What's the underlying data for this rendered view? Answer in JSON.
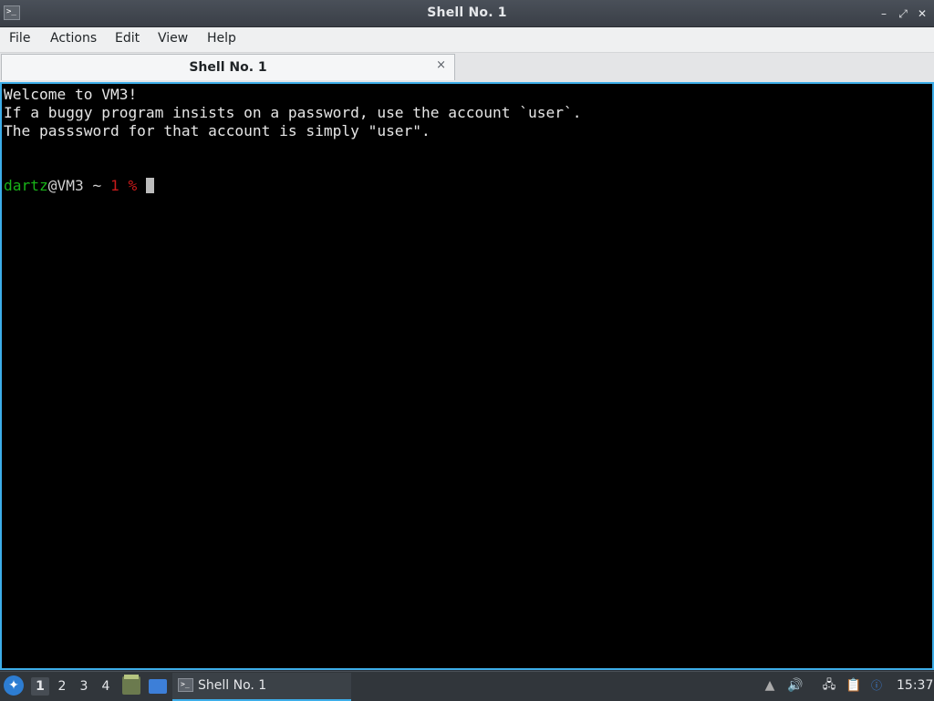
{
  "window": {
    "title": "Shell No. 1",
    "icon": "terminal-icon",
    "controls": {
      "minimize": "–",
      "maximize": "⤢",
      "close": "✕"
    }
  },
  "menu": {
    "file": "File",
    "actions": "Actions",
    "edit": "Edit",
    "view": "View",
    "help": "Help"
  },
  "tabs": [
    {
      "label": "Shell No. 1",
      "close": "×"
    }
  ],
  "terminal": {
    "lines": [
      "Welcome to VM3!",
      "If a buggy program insists on a password, use the account `user`.",
      "The passsword for that account is simply \"user\"."
    ],
    "prompt": {
      "user": "dartz",
      "host": "@VM3",
      "path": " ~ ",
      "num": "1 %",
      "input": ""
    }
  },
  "taskbar": {
    "launcher": "launcher-icon",
    "desktops": [
      "1",
      "2",
      "3",
      "4"
    ],
    "active_desktop": "1",
    "task_label": "Shell No. 1",
    "clock": "15:37"
  },
  "colors": {
    "accent": "#3daee9",
    "prompt_user": "#18b218",
    "prompt_num": "#c81a1a"
  }
}
